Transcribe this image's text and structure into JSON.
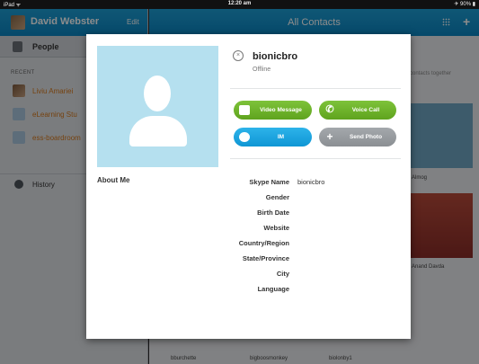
{
  "status_bar": {
    "left": "iPad ᯤ",
    "time": "12:20 am",
    "right": "✈ 90% ▮"
  },
  "sidebar": {
    "user_name": "David Webster",
    "edit_label": "Edit",
    "people_label": "People",
    "recent_header": "RECENT",
    "recent_items": [
      {
        "label": "Liviu Amariei"
      },
      {
        "label": "eLearning Stu"
      },
      {
        "label": "ess-boardroom"
      }
    ],
    "history_label": "History"
  },
  "main": {
    "title": "All Contacts",
    "hint": "contacts together",
    "tiles": [
      {
        "label": "Almog"
      },
      {
        "label": "Anand Davda"
      },
      {
        "label": "bburchette"
      },
      {
        "label": "bigboosmonkey"
      },
      {
        "label": "biolonby1"
      }
    ]
  },
  "profile": {
    "username": "bionicbro",
    "status": "Offline",
    "about_label": "About Me",
    "buttons": {
      "video": "Video Message",
      "voice": "Voice Call",
      "im": "IM",
      "photo": "Send Photo"
    },
    "fields": [
      {
        "label": "Skype Name",
        "value": "bionicbro"
      },
      {
        "label": "Gender",
        "value": ""
      },
      {
        "label": "Birth Date",
        "value": ""
      },
      {
        "label": "Website",
        "value": ""
      },
      {
        "label": "Country/Region",
        "value": ""
      },
      {
        "label": "State/Province",
        "value": ""
      },
      {
        "label": "City",
        "value": ""
      },
      {
        "label": "Language",
        "value": ""
      }
    ]
  },
  "colors": {
    "accent": "#0b85c2",
    "green": "#6cb22a",
    "blue": "#1aa4e0",
    "gray": "#979b9f",
    "recent": "#d5781c"
  },
  "icons": [
    "avatar",
    "people-icon",
    "history-icon",
    "grid-icon",
    "plus-icon",
    "offline-status-icon",
    "video-camera-icon",
    "phone-icon",
    "chat-icon",
    "plus-icon"
  ]
}
